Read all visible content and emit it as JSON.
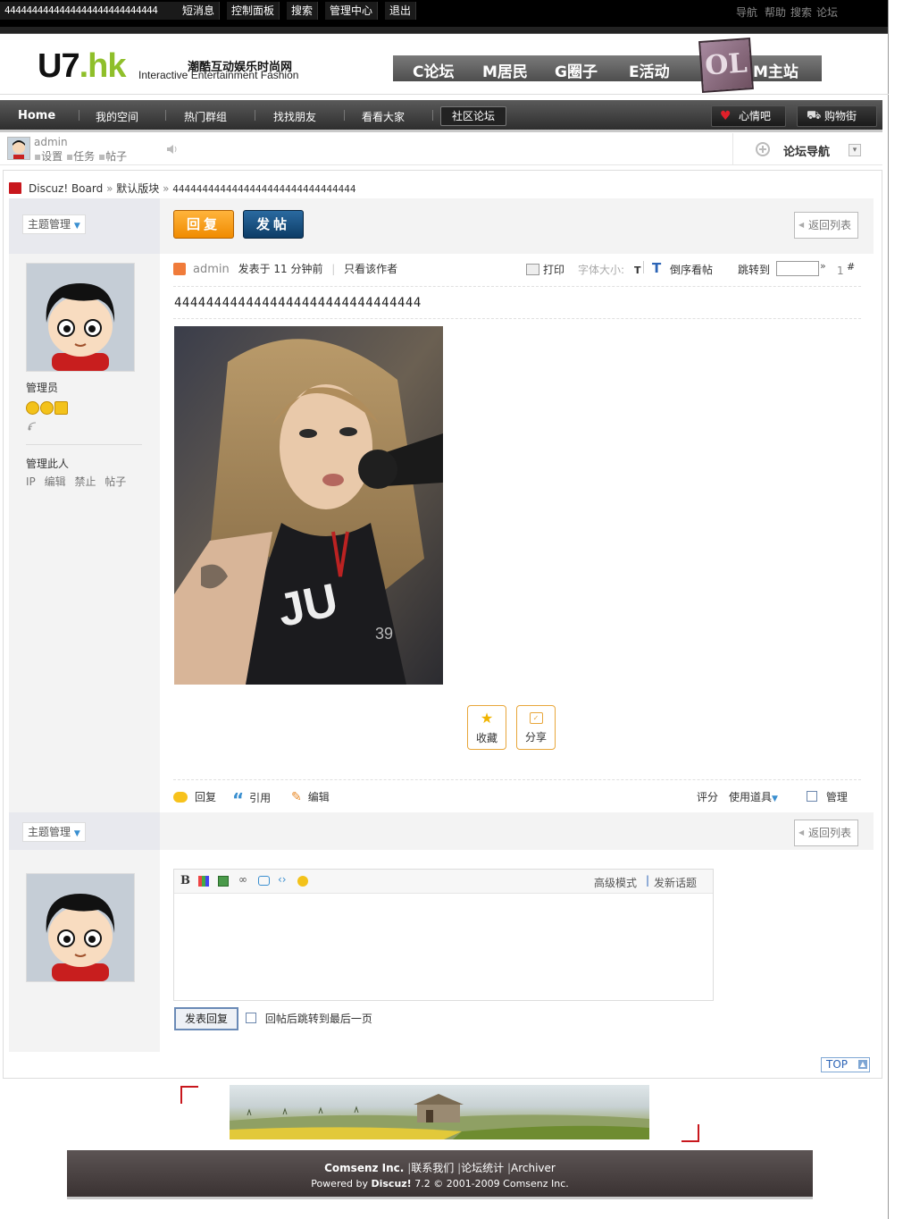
{
  "topbar": {
    "user": "4444444444444444444444444444",
    "links": [
      "短消息",
      "控制面板",
      "搜索",
      "管理中心",
      "退出"
    ],
    "right_links": [
      "导航",
      "帮助",
      "搜索",
      "论坛"
    ]
  },
  "header": {
    "logo_main": "U7",
    "logo_suffix": ".hk",
    "logo_cn": "潮酷互动娱乐时尚网",
    "logo_en": "Interactive Entertainment Fashion",
    "main_nav": [
      "C论坛",
      "M居民",
      "G圈子",
      "E活动",
      "M主站"
    ],
    "cube_text": "OL"
  },
  "menubar": {
    "home": "Home",
    "items": [
      "我的空间",
      "热门群组",
      "找找朋友",
      "看看大家",
      "社区论坛"
    ],
    "active_index": 4,
    "btn_heart": "心情吧",
    "btn_cart": "购物街"
  },
  "userbar": {
    "username": "admin",
    "links": [
      "设置",
      "任务",
      "帖子"
    ],
    "forum_nav": "论坛导航"
  },
  "breadcrumb": {
    "board": "Discuz! Board",
    "forum": "默认版块",
    "thread": "4444444444444444444444444444444"
  },
  "thread": {
    "mgmt_label": "主题管理",
    "reply_btn": "回复",
    "post_btn": "发帖",
    "back_btn": "返回列表"
  },
  "author": {
    "role": "管理员",
    "manage_title": "管理此人",
    "manage_links": [
      "IP",
      "编辑",
      "禁止",
      "帖子"
    ]
  },
  "post": {
    "author": "admin",
    "posted": "发表于 11 分钟前",
    "only_author": "只看该作者",
    "print": "打印",
    "font_size": "字体大小:",
    "font_small": "T",
    "font_big": "T",
    "reverse": "倒序看帖",
    "jump": "跳转到",
    "floor_num": "1",
    "floor_hash": "#",
    "title": "4444444444444444444444444444444",
    "watermark": "39",
    "shirt_text": "JU",
    "fav": "收藏",
    "share": "分享",
    "actions_left": [
      "回复",
      "引用",
      "编辑"
    ],
    "rate": "评分",
    "tools": "使用道具",
    "manage": "管理"
  },
  "editor": {
    "bold": "B",
    "advanced": "高级模式",
    "new_topic": "发新话题",
    "submit": "发表回复",
    "jump_last": "回帖后跳转到最后一页"
  },
  "top_btn": "TOP",
  "footer": {
    "company": "Comsenz Inc.",
    "links": [
      "联系我们",
      "论坛统计",
      "Archiver"
    ],
    "powered": "Powered by",
    "product": "Discuz!",
    "version": "7.2",
    "copyright": "© 2001-2009 Comsenz Inc."
  }
}
